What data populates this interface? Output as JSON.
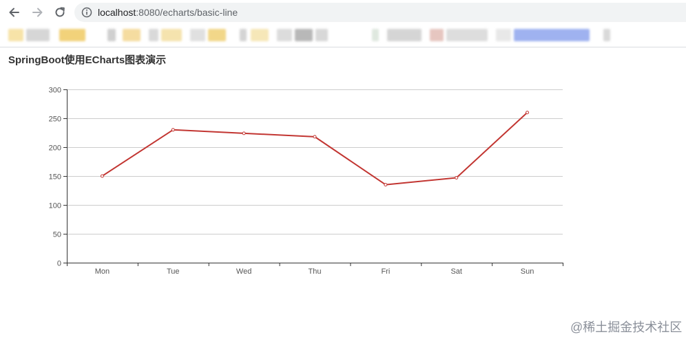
{
  "browser": {
    "url_host": "localhost",
    "url_rest": ":8080/echarts/basic-line"
  },
  "bookmarks": [
    {
      "color": "#f7e3a8"
    },
    {
      "color": "#d6d6d6"
    },
    {
      "color": "#f2d27a"
    },
    {
      "color": "#d0d0d0"
    },
    {
      "color": "#f5dca0"
    },
    {
      "color": "#d9d9d9"
    },
    {
      "color": "#f5e3ae"
    },
    {
      "color": "#e0e0e0"
    },
    {
      "color": "#f2d789"
    },
    {
      "color": "#d4d4d4"
    },
    {
      "color": "#f6e7b8"
    },
    {
      "color": "#dcdcdc"
    },
    {
      "color": "#b8b8b8"
    },
    {
      "color": "#d8d8d8"
    },
    {
      "color": "#dfe8df"
    },
    {
      "color": "#d5d5d5"
    },
    {
      "color": "#e6c6c0"
    },
    {
      "color": "#dddddd"
    },
    {
      "color": "#e8e8e8"
    },
    {
      "color": "#9fb2f0"
    },
    {
      "color": "#d9d9d9"
    }
  ],
  "page": {
    "title": "SpringBoot使用ECharts图表演示"
  },
  "chart_data": {
    "type": "line",
    "categories": [
      "Mon",
      "Tue",
      "Wed",
      "Thu",
      "Fri",
      "Sat",
      "Sun"
    ],
    "series": [
      {
        "values": [
          150,
          230,
          224,
          218,
          135,
          147,
          260
        ]
      }
    ],
    "ylim": [
      0,
      300
    ],
    "yticks": [
      0,
      50,
      100,
      150,
      200,
      250,
      300
    ],
    "grid": "horizontal",
    "line_color": "#c23531",
    "axis_color": "#333333",
    "grid_color": "#cccccc",
    "label_color": "#555555"
  },
  "watermark": {
    "text": "@稀土掘金技术社区"
  }
}
